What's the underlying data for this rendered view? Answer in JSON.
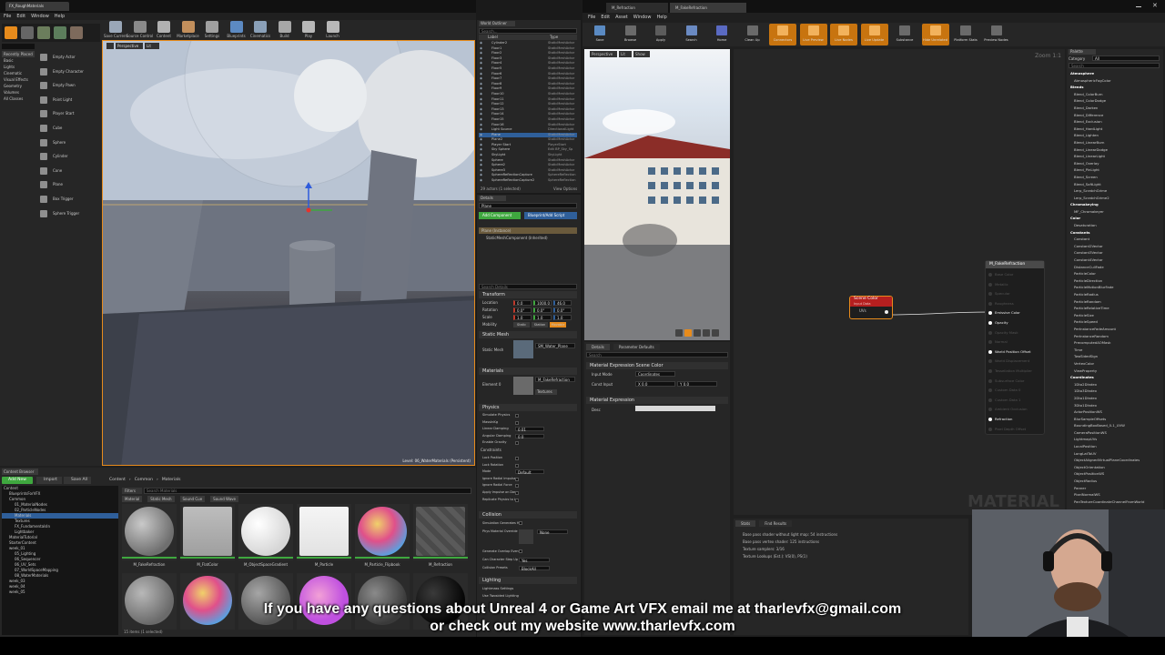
{
  "colors": {
    "accent_orange": "#e78b1c",
    "accent_green": "#3fa83f",
    "node_red": "#b51f1f",
    "panel_bg": "#262626",
    "selection_blue": "#2f5f9a"
  },
  "left_editor": {
    "tab_title": "FX_RoughMaterials",
    "menu": [
      "File",
      "Edit",
      "Window",
      "Help"
    ],
    "modes_label": "Modes",
    "place_categories": [
      "Recently Placed",
      "Basic",
      "Lights",
      "Cinematic",
      "Visual Effects",
      "Geometry",
      "Volumes",
      "All Classes"
    ],
    "place_items": [
      "Empty Actor",
      "Empty Character",
      "Empty Pawn",
      "Point Light",
      "Player Start",
      "Cube",
      "Sphere",
      "Cylinder",
      "Cone",
      "Plane",
      "Box Trigger",
      "Sphere Trigger"
    ],
    "toolbar": [
      "Save Current",
      "Source Control",
      "Content",
      "Marketplace",
      "Settings",
      "Blueprints",
      "Cinematics",
      "Build",
      "Play",
      "Launch"
    ],
    "viewport": {
      "perspective": "Perspective",
      "lit": "Lit",
      "level_label": "Level: 06_WaterMaterials (Persistent)"
    },
    "content_browser": {
      "tab_title": "Content Browser",
      "add_new": "Add New",
      "import": "Import",
      "save_all": "Save All",
      "path": [
        "Content",
        "Common",
        "Materials"
      ],
      "filters": "Filters",
      "search_placeholder": "Search Materials",
      "filter_chips": [
        "Material",
        "Static Mesh",
        "Sound Cue",
        "Sound Wave"
      ],
      "tree": [
        "Content",
        "BlueprintsForVFX",
        "Common",
        "01_MaterialNodes",
        "02_ParticleNodes",
        "Materials",
        "Textures",
        "FX_FundamentalsIn",
        "Lightbaker",
        "MaterialTutorial",
        "StarterContent",
        "week_01",
        "05_Lighting",
        "06_Sequencer",
        "06_UV_Sets",
        "07_WorldSpaceMapping",
        "08_WaterMaterials",
        "week_03",
        "week_04",
        "week_05"
      ],
      "assets": [
        "M_FakeRefraction",
        "M_FlatColor",
        "M_ObjectSpaceGradient",
        "M_Particle",
        "M_Particle_Flipbook",
        "M_Refraction"
      ],
      "status": "15 items (1 selected)"
    }
  },
  "world_outliner": {
    "title": "World Outliner",
    "search_placeholder": "Search...",
    "columns": [
      "Label",
      "Type"
    ],
    "rows": [
      {
        "label": "Cylinder2",
        "type": "StaticMeshActor"
      },
      {
        "label": "Floor1",
        "type": "StaticMeshActor"
      },
      {
        "label": "Floor2",
        "type": "StaticMeshActor"
      },
      {
        "label": "Floor3",
        "type": "StaticMeshActor"
      },
      {
        "label": "Floor4",
        "type": "StaticMeshActor"
      },
      {
        "label": "Floor5",
        "type": "StaticMeshActor"
      },
      {
        "label": "Floor6",
        "type": "StaticMeshActor"
      },
      {
        "label": "Floor7",
        "type": "StaticMeshActor"
      },
      {
        "label": "Floor8",
        "type": "StaticMeshActor"
      },
      {
        "label": "Floor9",
        "type": "StaticMeshActor"
      },
      {
        "label": "Floor10",
        "type": "StaticMeshActor"
      },
      {
        "label": "Floor11",
        "type": "StaticMeshActor"
      },
      {
        "label": "Floor12",
        "type": "StaticMeshActor"
      },
      {
        "label": "Floor13",
        "type": "StaticMeshActor"
      },
      {
        "label": "Floor14",
        "type": "StaticMeshActor"
      },
      {
        "label": "Floor15",
        "type": "StaticMeshActor"
      },
      {
        "label": "Floor16",
        "type": "StaticMeshActor"
      },
      {
        "label": "Light Source",
        "type": "DirectionalLight"
      },
      {
        "label": "Plane",
        "type": "StaticMeshActor"
      },
      {
        "label": "Plane2",
        "type": "StaticMeshActor"
      },
      {
        "label": "Player Start",
        "type": "PlayerStart"
      },
      {
        "label": "Sky Sphere",
        "type": "Edit BP_Sky_Sp"
      },
      {
        "label": "SkyLight",
        "type": "SkyLight"
      },
      {
        "label": "Sphere",
        "type": "StaticMeshActor"
      },
      {
        "label": "Sphere2",
        "type": "StaticMeshActor"
      },
      {
        "label": "Sphere3",
        "type": "StaticMeshActor"
      },
      {
        "label": "SphereReflectionCapture",
        "type": "SphereReflection"
      },
      {
        "label": "SphereReflectionCapture2",
        "type": "SphereReflection"
      }
    ],
    "status": "29 actors (1 selected)",
    "view_options": "View Options"
  },
  "details": {
    "title": "Details",
    "selected_name": "Plane",
    "add_component": "Add Component",
    "blueprint_add": "Blueprint/Add Script",
    "root_component": "Plane (Instance)",
    "sub_component": "StaticMeshComponent (Inherited)",
    "search_placeholder": "Search Details",
    "sections": {
      "transform": "Transform",
      "static_mesh": "Static Mesh",
      "materials": "Materials",
      "physics": "Physics",
      "collision": "Collision",
      "lighting": "Lighting"
    },
    "transform_labels": [
      "Location",
      "Rotation",
      "Scale",
      "Mobility"
    ],
    "location": [
      "0.0",
      "1000.0",
      "46.0"
    ],
    "rotation": [
      "0.0°",
      "0.0°",
      "0.0°"
    ],
    "scale": [
      "1.0",
      "1.0",
      "1.0"
    ],
    "mobility_options": [
      "Static",
      "Station",
      "Movable"
    ],
    "static_mesh_label": "Static Mesh",
    "static_mesh_value": "SM_Water_Plane",
    "element_label": "Element 0",
    "element_value": "M_FakeRefraction",
    "textures_btn": "Textures",
    "physics_rows": [
      "Simulate Physics",
      "MassInKg",
      "Linear Damping",
      "Angular Damping",
      "Enable Gravity"
    ],
    "physics_values": [
      "",
      "",
      "0.01",
      "0.0",
      ""
    ],
    "constraints_label": "Constraints",
    "constraint_rows": [
      "Lock Position",
      "Lock Rotation",
      "Mode",
      "Ignore Radial Impulse",
      "Ignore Radial Force",
      "Apply Impulse on Damage",
      "Replicate Physics to Autonomous Proxy"
    ],
    "mode_value": "Default",
    "collision_rows": [
      "Simulation Generates Hit Events",
      "Phys Material Override",
      "Generate Overlap Events",
      "Can Character Step Up On",
      "Collision Presets"
    ],
    "phys_material_value": "None",
    "can_step_value": "Yes",
    "collision_preset_value": "BlockAll",
    "lighting_rows": [
      "Lightmass Settings",
      "Use Twosided Lighting"
    ]
  },
  "material_editor": {
    "tab_title": "M_Refraction",
    "tab_title_2": "M_FakeRefraction",
    "menu": [
      "File",
      "Edit",
      "Asset",
      "Window",
      "Help"
    ],
    "toolbar": [
      "Save",
      "Browse",
      "Apply",
      "Search",
      "Home",
      "Clean Up",
      "Connectors",
      "Live Preview",
      "Live Nodes",
      "Live Update",
      "Substance",
      "Hide Unrelated",
      "Platform Stats",
      "Preview Nodes"
    ],
    "viewport": {
      "perspective": "Perspective",
      "lit": "Lit",
      "show": "Show"
    },
    "details_tabs": [
      "Details",
      "Parameter Defaults"
    ],
    "search_placeholder": "Search",
    "scene_color_section": "Material Expression Scene Color",
    "input_mode_label": "Input Mode",
    "input_mode_value": "Coordinates",
    "const_input_label": "Const Input",
    "const_input_x": "X 0.0",
    "const_input_y": "Y 0.0",
    "material_expression_section": "Material Expression",
    "desc_label": "Desc",
    "zoom": "Zoom 1:1",
    "watermark": "MATERIAL",
    "scene_color_node": {
      "title": "Scene Color",
      "subtitle": "Input Data",
      "pin": "UVs"
    },
    "result_node": {
      "title": "M_FakeRefraction",
      "pins": [
        {
          "label": "Base Color",
          "active": false
        },
        {
          "label": "Metallic",
          "active": false
        },
        {
          "label": "Specular",
          "active": false
        },
        {
          "label": "Roughness",
          "active": false
        },
        {
          "label": "Emissive Color",
          "active": true
        },
        {
          "label": "Opacity",
          "active": true
        },
        {
          "label": "Opacity Mask",
          "active": false
        },
        {
          "label": "Normal",
          "active": false
        },
        {
          "label": "World Position Offset",
          "active": true
        },
        {
          "label": "World Displacement",
          "active": false
        },
        {
          "label": "Tessellation Multiplier",
          "active": false
        },
        {
          "label": "Subsurface Color",
          "active": false
        },
        {
          "label": "Custom Data 0",
          "active": false
        },
        {
          "label": "Custom Data 1",
          "active": false
        },
        {
          "label": "Ambient Occlusion",
          "active": false
        },
        {
          "label": "Refraction",
          "active": true
        },
        {
          "label": "Pixel Depth Offset",
          "active": false
        }
      ]
    },
    "stats_tabs": [
      "Stats",
      "Find Results"
    ],
    "stats_lines": [
      "Base pass shader without light map: 54 instructions",
      "Base pass vertex shader: 125 instructions",
      "Texture samplers: 3/16",
      "Texture Lookups (Est.): VS(0), PS(1)"
    ]
  },
  "palette": {
    "title": "Palette",
    "category_label": "Category",
    "category_value": "All",
    "search_placeholder": "Search",
    "items": [
      {
        "text": "Atmosphere",
        "cat": true
      },
      {
        "text": "AtmosphericFogColor",
        "cat": false
      },
      {
        "text": "Blends",
        "cat": true
      },
      {
        "text": "Blend_ColorBurn",
        "cat": false
      },
      {
        "text": "Blend_ColorDodge",
        "cat": false
      },
      {
        "text": "Blend_Darken",
        "cat": false
      },
      {
        "text": "Blend_Difference",
        "cat": false
      },
      {
        "text": "Blend_Exclusion",
        "cat": false
      },
      {
        "text": "Blend_HardLight",
        "cat": false
      },
      {
        "text": "Blend_Lighten",
        "cat": false
      },
      {
        "text": "Blend_LinearBurn",
        "cat": false
      },
      {
        "text": "Blend_LinearDodge",
        "cat": false
      },
      {
        "text": "Blend_LinearLight",
        "cat": false
      },
      {
        "text": "Blend_Overlay",
        "cat": false
      },
      {
        "text": "Blend_PinLight",
        "cat": false
      },
      {
        "text": "Blend_Screen",
        "cat": false
      },
      {
        "text": "Blend_SoftLight",
        "cat": false
      },
      {
        "text": "Lerp_ScratchGrime",
        "cat": false
      },
      {
        "text": "Lerp_ScratchGrime2",
        "cat": false
      },
      {
        "text": "Chromakeying",
        "cat": true
      },
      {
        "text": "MF_Chromakeyer",
        "cat": false
      },
      {
        "text": "Color",
        "cat": true
      },
      {
        "text": "Desaturation",
        "cat": false
      },
      {
        "text": "Constants",
        "cat": true
      },
      {
        "text": "Constant",
        "cat": false
      },
      {
        "text": "Constant2Vector",
        "cat": false
      },
      {
        "text": "Constant3Vector",
        "cat": false
      },
      {
        "text": "Constant4Vector",
        "cat": false
      },
      {
        "text": "DistanceCullFade",
        "cat": false
      },
      {
        "text": "ParticleColor",
        "cat": false
      },
      {
        "text": "ParticleDirection",
        "cat": false
      },
      {
        "text": "ParticleMotionBlurFade",
        "cat": false
      },
      {
        "text": "ParticleRadius",
        "cat": false
      },
      {
        "text": "ParticleRandom",
        "cat": false
      },
      {
        "text": "ParticleRelativeTime",
        "cat": false
      },
      {
        "text": "ParticleSize",
        "cat": false
      },
      {
        "text": "ParticleSpeed",
        "cat": false
      },
      {
        "text": "PerInstanceFadeAmount",
        "cat": false
      },
      {
        "text": "PerInstanceRandom",
        "cat": false
      },
      {
        "text": "PrecomputedAOMask",
        "cat": false
      },
      {
        "text": "Time",
        "cat": false
      },
      {
        "text": "TwoSidedSign",
        "cat": false
      },
      {
        "text": "VertexColor",
        "cat": false
      },
      {
        "text": "ViewProperty",
        "cat": false
      },
      {
        "text": "Coordinates",
        "cat": true
      },
      {
        "text": "1Dto2DIndex",
        "cat": false
      },
      {
        "text": "1Dto3DIndex",
        "cat": false
      },
      {
        "text": "2Dto1DIndex",
        "cat": false
      },
      {
        "text": "3Dto1DIndex",
        "cat": false
      },
      {
        "text": "ActorPositionWS",
        "cat": false
      },
      {
        "text": "BlurSampleOffsets",
        "cat": false
      },
      {
        "text": "BoundingBoxBased_0-1_UVW",
        "cat": false
      },
      {
        "text": "CameraPositionWS",
        "cat": false
      },
      {
        "text": "LightmapUVs",
        "cat": false
      },
      {
        "text": "LocalPosition",
        "cat": false
      },
      {
        "text": "LongLatToUV",
        "cat": false
      },
      {
        "text": "ObjectAlignedVirtualPlaneCoordinates",
        "cat": false
      },
      {
        "text": "ObjectOrientation",
        "cat": false
      },
      {
        "text": "ObjectPositionWS",
        "cat": false
      },
      {
        "text": "ObjectRadius",
        "cat": false
      },
      {
        "text": "Panner",
        "cat": false
      },
      {
        "text": "PixelNormalWS",
        "cat": false
      },
      {
        "text": "PanTextureCoordinateChannelFromWorld",
        "cat": false
      }
    ]
  },
  "caption": {
    "line1": "If you have any questions about Unreal 4 or Game Art VFX email me at tharlevfx@gmail.com",
    "line2": "or check out my website www.tharlevfx.com"
  }
}
